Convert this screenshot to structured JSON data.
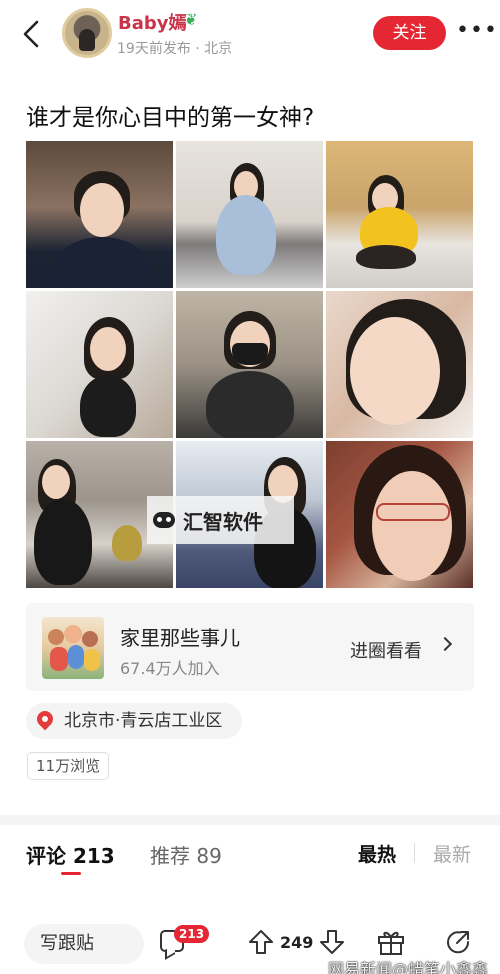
{
  "header": {
    "author_name": "Baby嫣",
    "post_meta": "19天前发布 · 北京",
    "follow_label": "关注",
    "more_label": "•••"
  },
  "post": {
    "title": "谁才是你心目中的第一女神?",
    "watermark_text": "汇智软件"
  },
  "circle": {
    "name": "家里那些事儿",
    "members": "67.4万人加入",
    "enter_label": "进圈看看"
  },
  "location": {
    "text": "北京市·青云店工业区"
  },
  "views": {
    "text": "11万浏览"
  },
  "comments": {
    "tab_comments": "评论 213",
    "tab_recommend": "推荐 89",
    "sort_hot": "最热",
    "sort_new": "最新"
  },
  "bottom_bar": {
    "reply_placeholder": "写跟贴",
    "comment_badge": "213",
    "vote_count": "249",
    "source_watermark": "网易新闻@蜡笔小鑫鑫"
  },
  "colors": {
    "accent": "#e52733",
    "author_name": "#c9344b"
  }
}
